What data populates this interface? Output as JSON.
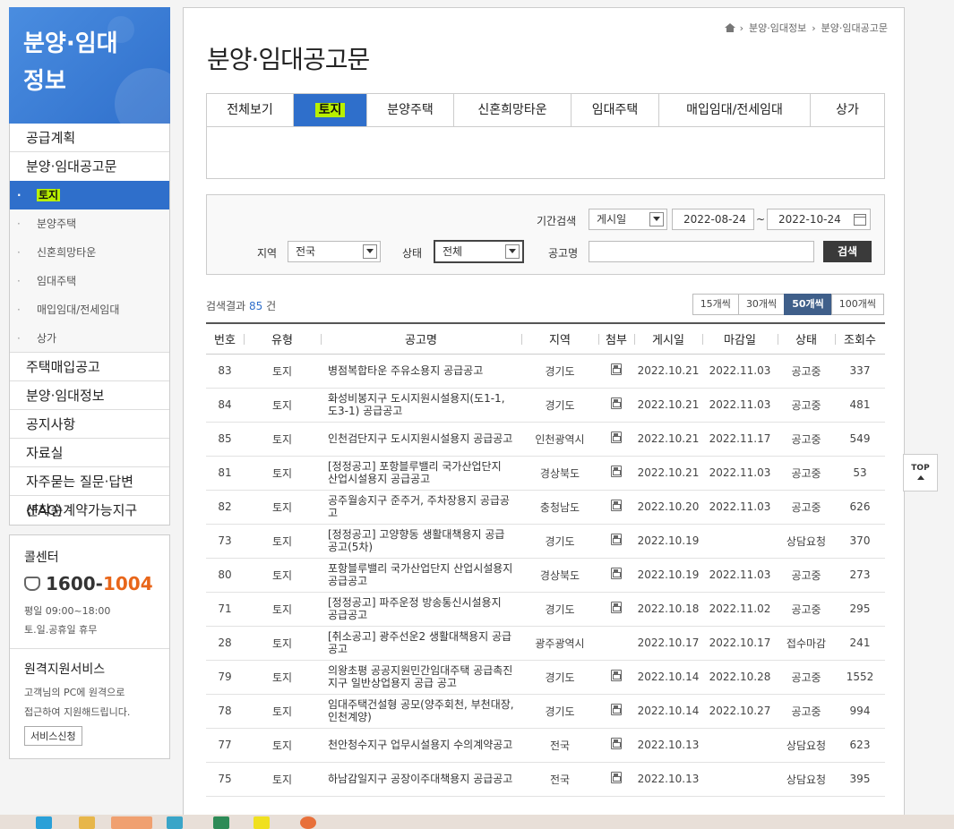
{
  "sidebar": {
    "hero_title_line1": "분양·임대",
    "hero_title_line2": "정보",
    "menu": {
      "supply_plan": "공급계획",
      "sale_rent_notice": "분양·임대공고문",
      "sub_items": [
        "토지",
        "분양주택",
        "신혼희망타운",
        "임대주택",
        "매입임대/전세임대",
        "상가"
      ],
      "house_purchase": "주택매입공고",
      "sale_rent_info": "분양·임대정보",
      "notice": "공지사항",
      "resources": "자료실",
      "faq": "자주묻는 질문·답변(FAQ)",
      "first_come": "선착순계약가능지구"
    },
    "call_center": {
      "heading": "콜센터",
      "number_a": "1600-",
      "number_b": "1004",
      "hours": "평일 09:00~18:00",
      "closed": "토.일.공휴일 휴무"
    },
    "remote": {
      "heading": "원격지원서비스",
      "line1": "고객님의 PC에 원격으로",
      "line2": "접근하여 지원해드립니다.",
      "button": "서비스신청"
    }
  },
  "breadcrumb": [
    "분양·임대정보",
    "분양·임대공고문"
  ],
  "page_title": "분양·임대공고문",
  "tabs": [
    "전체보기",
    "토지",
    "분양주택",
    "신혼희망타운",
    "임대주택",
    "매입임대/전세임대",
    "상가"
  ],
  "search": {
    "period_label": "기간검색",
    "period_select": "게시일",
    "date_from": "2022-08-24",
    "date_sep": "~",
    "date_to": "2022-10-24",
    "region_label": "지역",
    "region_value": "전국",
    "status_label": "상태",
    "status_value": "전체",
    "name_label": "공고명",
    "name_value": "",
    "button": "검색"
  },
  "result": {
    "prefix": "검색결과",
    "count": "85",
    "suffix": "건"
  },
  "page_sizes": [
    "15개씩",
    "30개씩",
    "50개씩",
    "100개씩"
  ],
  "table": {
    "headers": [
      "번호",
      "유형",
      "공고명",
      "지역",
      "첨부",
      "게시일",
      "마감일",
      "상태",
      "조회수"
    ],
    "rows": [
      {
        "no": "83",
        "type": "토지",
        "title": "병점복합타운 주유소용지 공급공고",
        "region": "경기도",
        "attach": true,
        "posted": "2022.10.21",
        "deadline": "2022.11.03",
        "status": "공고중",
        "views": "337"
      },
      {
        "no": "84",
        "type": "토지",
        "title": "화성비봉지구 도시지원시설용지(도1-1,도3-1) 공급공고",
        "region": "경기도",
        "attach": true,
        "posted": "2022.10.21",
        "deadline": "2022.11.03",
        "status": "공고중",
        "views": "481"
      },
      {
        "no": "85",
        "type": "토지",
        "title": "인천검단지구 도시지원시설용지 공급공고",
        "region": "인천광역시",
        "attach": true,
        "posted": "2022.10.21",
        "deadline": "2022.11.17",
        "status": "공고중",
        "views": "549"
      },
      {
        "no": "81",
        "type": "토지",
        "title": "[정정공고] 포항블루밸리 국가산업단지 산업시설용지 공급공고",
        "region": "경상북도",
        "attach": true,
        "posted": "2022.10.21",
        "deadline": "2022.11.03",
        "status": "공고중",
        "views": "53"
      },
      {
        "no": "82",
        "type": "토지",
        "title": "공주월송지구 준주거, 주차장용지 공급공고",
        "region": "충청남도",
        "attach": true,
        "posted": "2022.10.20",
        "deadline": "2022.11.03",
        "status": "공고중",
        "views": "626"
      },
      {
        "no": "73",
        "type": "토지",
        "title": "[정정공고] 고양향동 생활대책용지 공급공고(5차)",
        "region": "경기도",
        "attach": true,
        "posted": "2022.10.19",
        "deadline": "",
        "status": "상담요청",
        "views": "370"
      },
      {
        "no": "80",
        "type": "토지",
        "title": "포항블루밸리 국가산업단지 산업시설용지 공급공고",
        "region": "경상북도",
        "attach": true,
        "posted": "2022.10.19",
        "deadline": "2022.11.03",
        "status": "공고중",
        "views": "273"
      },
      {
        "no": "71",
        "type": "토지",
        "title": "[정정공고] 파주운정 방송통신시설용지 공급공고",
        "region": "경기도",
        "attach": true,
        "posted": "2022.10.18",
        "deadline": "2022.11.02",
        "status": "공고중",
        "views": "295"
      },
      {
        "no": "28",
        "type": "토지",
        "title": "[취소공고] 광주선운2 생활대책용지 공급공고",
        "region": "광주광역시",
        "attach": false,
        "posted": "2022.10.17",
        "deadline": "2022.10.17",
        "status": "접수마감",
        "views": "241"
      },
      {
        "no": "79",
        "type": "토지",
        "title": "의왕초평 공공지원민간임대주택 공급촉진지구 일반상업용지 공급 공고",
        "region": "경기도",
        "attach": true,
        "posted": "2022.10.14",
        "deadline": "2022.10.28",
        "status": "공고중",
        "views": "1552"
      },
      {
        "no": "78",
        "type": "토지",
        "title": "임대주택건설형 공모(양주회천, 부천대장, 인천계양)",
        "region": "경기도",
        "attach": true,
        "posted": "2022.10.14",
        "deadline": "2022.10.27",
        "status": "공고중",
        "views": "994"
      },
      {
        "no": "77",
        "type": "토지",
        "title": "천안청수지구 업무시설용지 수의계약공고",
        "region": "전국",
        "attach": true,
        "posted": "2022.10.13",
        "deadline": "",
        "status": "상담요청",
        "views": "623"
      },
      {
        "no": "75",
        "type": "토지",
        "title": "하남감일지구 공장이주대책용지 공급공고",
        "region": "전국",
        "attach": true,
        "posted": "2022.10.13",
        "deadline": "",
        "status": "상담요청",
        "views": "395"
      }
    ]
  },
  "top_button": "TOP"
}
